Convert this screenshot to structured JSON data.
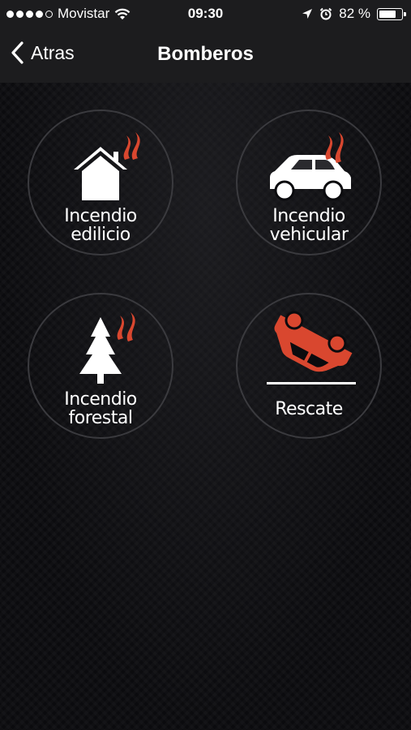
{
  "status_bar": {
    "carrier": "Movistar",
    "time": "09:30",
    "battery_percent": 82,
    "battery_text": "82 %",
    "icons": [
      "signal-dots-icon",
      "wifi-icon",
      "location-arrow-icon",
      "alarm-icon",
      "battery-icon"
    ]
  },
  "nav": {
    "back_label": "Atras",
    "title": "Bomberos"
  },
  "tiles": [
    {
      "line1": "Incendio",
      "line2": "edilicio",
      "icon": "house-fire-icon"
    },
    {
      "line1": "Incendio",
      "line2": "vehicular",
      "icon": "car-fire-icon"
    },
    {
      "line1": "Incendio",
      "line2": "forestal",
      "icon": "tree-fire-icon"
    },
    {
      "line1": "Rescate",
      "line2": "",
      "icon": "overturned-car-icon"
    }
  ],
  "colors": {
    "accent": "#d9472f",
    "background": "#0b0b0e",
    "bar": "#1c1c1e",
    "tile_border": "#3a3a3e"
  }
}
